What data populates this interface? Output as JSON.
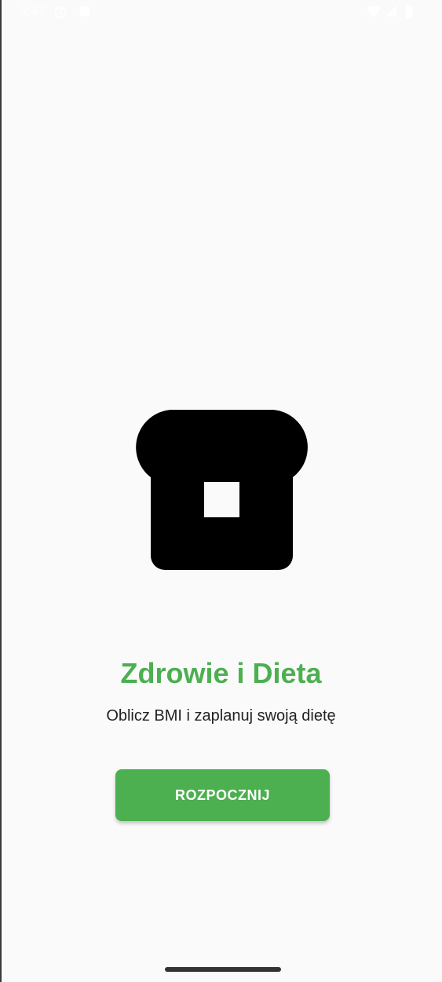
{
  "status_bar": {
    "time": "9:47",
    "icons": [
      "alarm-icon",
      "notification-icon",
      "wifi-icon",
      "signal-icon",
      "battery-icon"
    ]
  },
  "app_icon": {
    "name": "bread-icon",
    "color": "#000000"
  },
  "title": "Zdrowie i Dieta",
  "subtitle": "Oblicz BMI i zaplanuj swoją dietę",
  "start_button": {
    "label": "ROZPOCZNIJ"
  },
  "colors": {
    "accent": "#4caf50",
    "background": "#fafafa",
    "text": "#222222"
  }
}
